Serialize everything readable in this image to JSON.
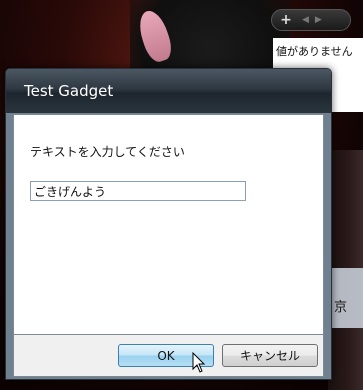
{
  "desktop": {
    "sidebar_toolbar": {
      "add_label": "+",
      "prev_label": "◀",
      "next_label": "▶"
    },
    "gadget_message": "値がありません",
    "partial_label": "京"
  },
  "dialog": {
    "title": "Test Gadget",
    "prompt": "テキストを入力してください",
    "input_value": "ごきげんよう",
    "ok_label": "OK",
    "cancel_label": "キャンセル"
  },
  "colors": {
    "title_bar": "#2e3842",
    "ok_border": "#3c7fb1"
  }
}
